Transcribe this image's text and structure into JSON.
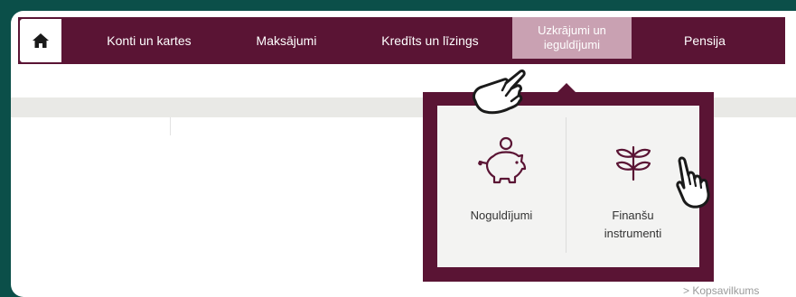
{
  "nav": {
    "items": [
      {
        "label": "Konti un kartes"
      },
      {
        "label": "Maksājumi"
      },
      {
        "label": "Kredīts un līzings"
      },
      {
        "label": "Uzkrājumi un ieguldījumi"
      },
      {
        "label": "Pensija"
      }
    ],
    "home_icon": "home-icon"
  },
  "dropdown": {
    "items": [
      {
        "label": "Noguldījumi",
        "icon": "piggy-bank-icon"
      },
      {
        "label": "Finanšu instrumenti",
        "icon": "plant-icon"
      }
    ]
  },
  "footer": {
    "link_label": "Kopsavilkums",
    "link_icon": "chevron-right-icon"
  },
  "colors": {
    "brand": "#5a1434",
    "active_tab": "#c9a1b2",
    "background": "#0b4f49"
  }
}
